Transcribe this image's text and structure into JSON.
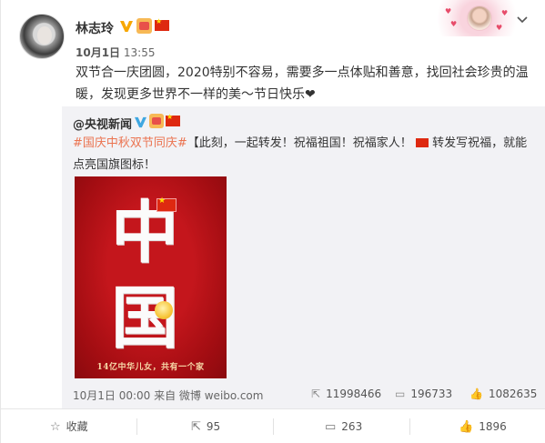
{
  "post": {
    "author": "林志玲",
    "date": "10月1日",
    "time": "13:55",
    "text": "双节合一庆团圆，2020特别不容易，需要多一点体贴和善意，找回社会珍贵的温暖，发现更多世界不一样的美～节日快乐❤"
  },
  "repost": {
    "author": "@央视新闻",
    "hashtag": "#国庆中秋双节同庆#",
    "text_part1": "【此刻，一起转发！祝福祖国！祝福家人！",
    "text_part2": "转发写祝福，就能点亮国旗图标！",
    "poster": {
      "char_top": "中",
      "char_bottom": "国",
      "slogan": "14亿中华儿女，共有一个家"
    },
    "meta": "10月1日 00:00 来自 微博 weibo.com",
    "reposts": "11998466",
    "comments": "196733",
    "likes": "1082635"
  },
  "actions": {
    "favorite_label": "收藏",
    "repost_count": "95",
    "comment_count": "263",
    "like_count": "1896"
  },
  "icons": {
    "verified": "verified-v-icon",
    "member": "member-crown-icon",
    "flag": "china-flag-icon",
    "chevron": "chevron-down-icon",
    "repost": "repost-icon",
    "comment": "comment-icon",
    "like": "like-icon",
    "favorite": "star-icon"
  },
  "colors": {
    "hashtag": "#eb7350",
    "verified": "#f7a700",
    "flag": "#de2910"
  }
}
